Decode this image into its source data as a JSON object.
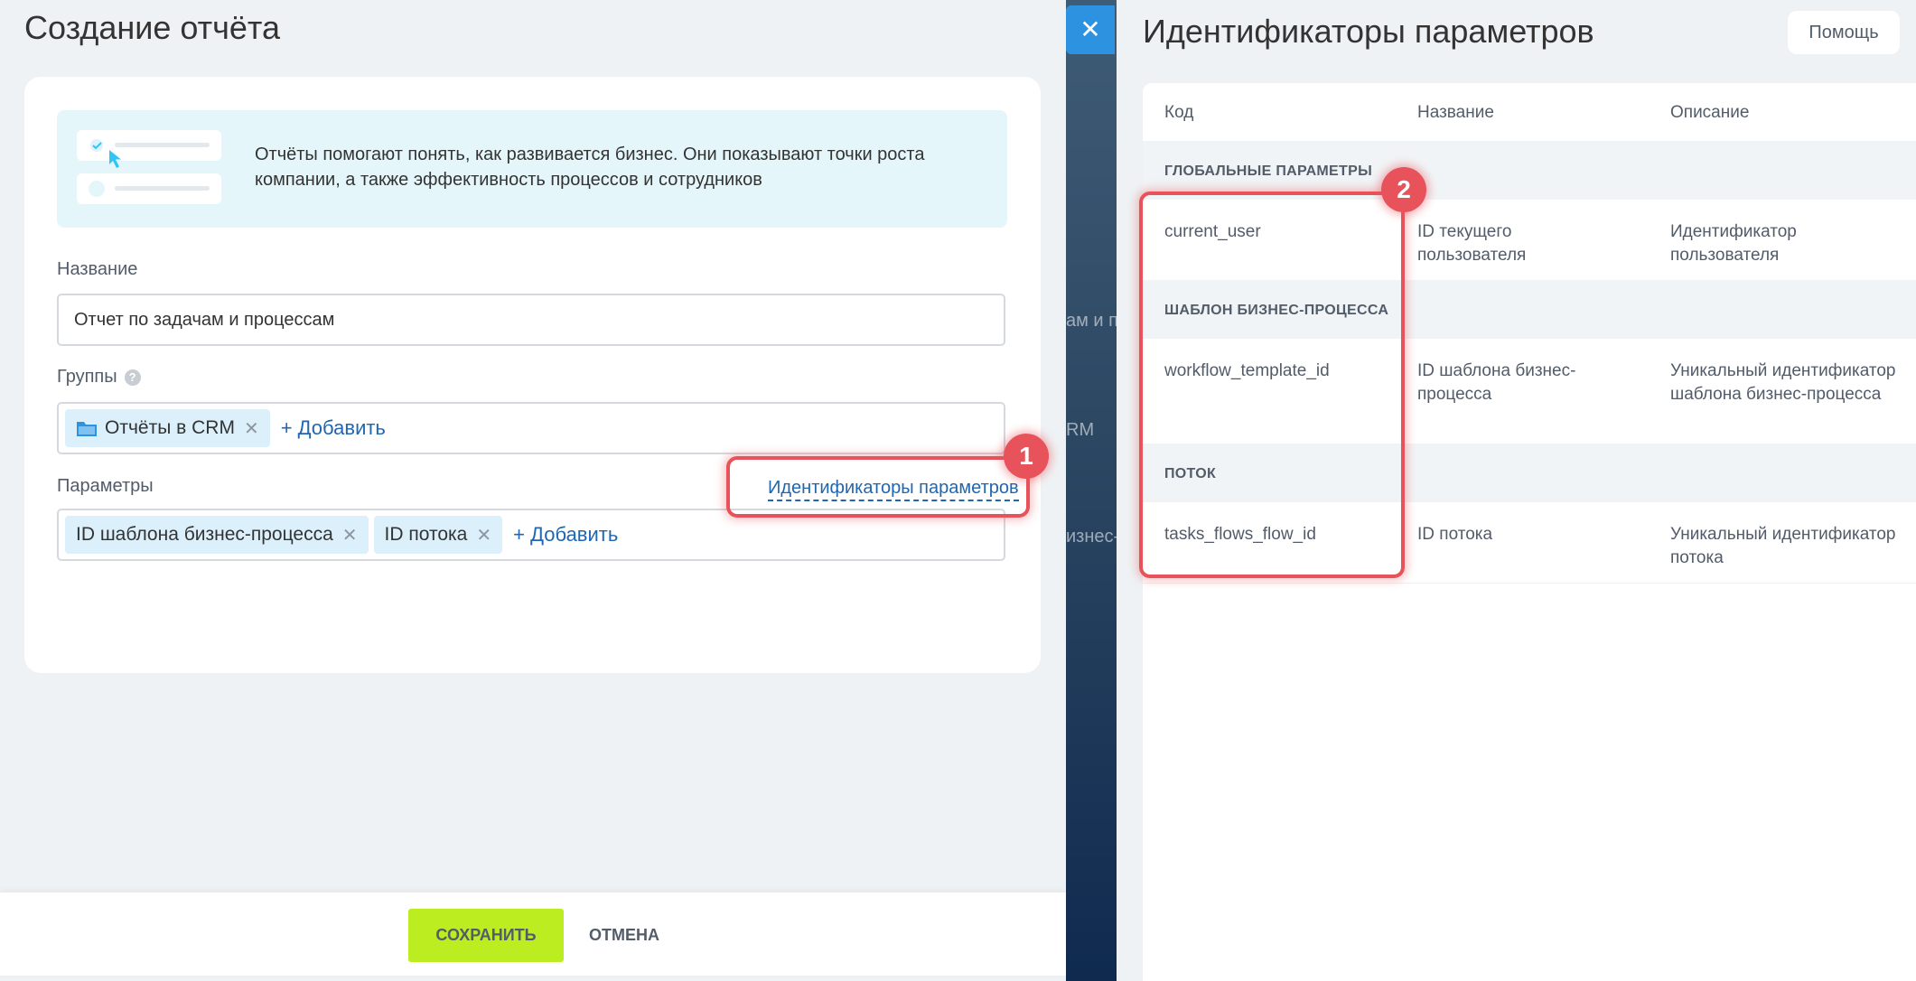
{
  "create_report": {
    "title": "Создание отчёта",
    "banner_text": "Отчёты помогают понять, как развивается бизнес. Они показывают точки роста компании, а также эффективность процессов и сотрудников",
    "name_label": "Название",
    "name_value": "Отчет по задачам и процессам",
    "groups_label": "Группы",
    "groups_tags": [
      {
        "label": "Отчёты в CRM"
      }
    ],
    "groups_add": "+ Добавить",
    "params_label": "Параметры",
    "params_tags": [
      {
        "label": "ID шаблона бизнес-процесса"
      },
      {
        "label": "ID потока"
      }
    ],
    "params_add": "+ Добавить",
    "param_ids_link": "Идентификаторы параметров",
    "save_label": "СОХРАНИТЬ",
    "cancel_label": "ОТМЕНА"
  },
  "background_fragments": [
    "ам и п",
    "RM",
    "изнес-"
  ],
  "callouts": [
    "1",
    "2"
  ],
  "param_ids": {
    "title": "Идентификаторы параметров",
    "help_label": "Помощь",
    "columns": [
      "Код",
      "Название",
      "Описание"
    ],
    "sections": [
      {
        "title": "ГЛОБАЛЬНЫЕ ПАРАМЕТРЫ",
        "rows": [
          {
            "code": "current_user",
            "name": "ID текущего пользователя",
            "description": "Идентификатор пользователя"
          }
        ]
      },
      {
        "title": "ШАБЛОН БИЗНЕС-ПРОЦЕССА",
        "rows": [
          {
            "code": "workflow_template_id",
            "name": "ID шаблона бизнес-процесса",
            "description": "Уникальный идентификатор шаблона бизнес-процесса"
          }
        ]
      },
      {
        "title": "ПОТОК",
        "rows": [
          {
            "code": "tasks_flows_flow_id",
            "name": "ID потока",
            "description": "Уникальный идентификатор потока"
          }
        ]
      }
    ]
  },
  "colors": {
    "accent_link": "#2066b0",
    "save_button": "#bbed21",
    "callout": "#e8525a",
    "close_button": "#2d93e0"
  },
  "icons": [
    "close-icon",
    "help-icon",
    "folder-icon",
    "tag-remove-icon"
  ]
}
